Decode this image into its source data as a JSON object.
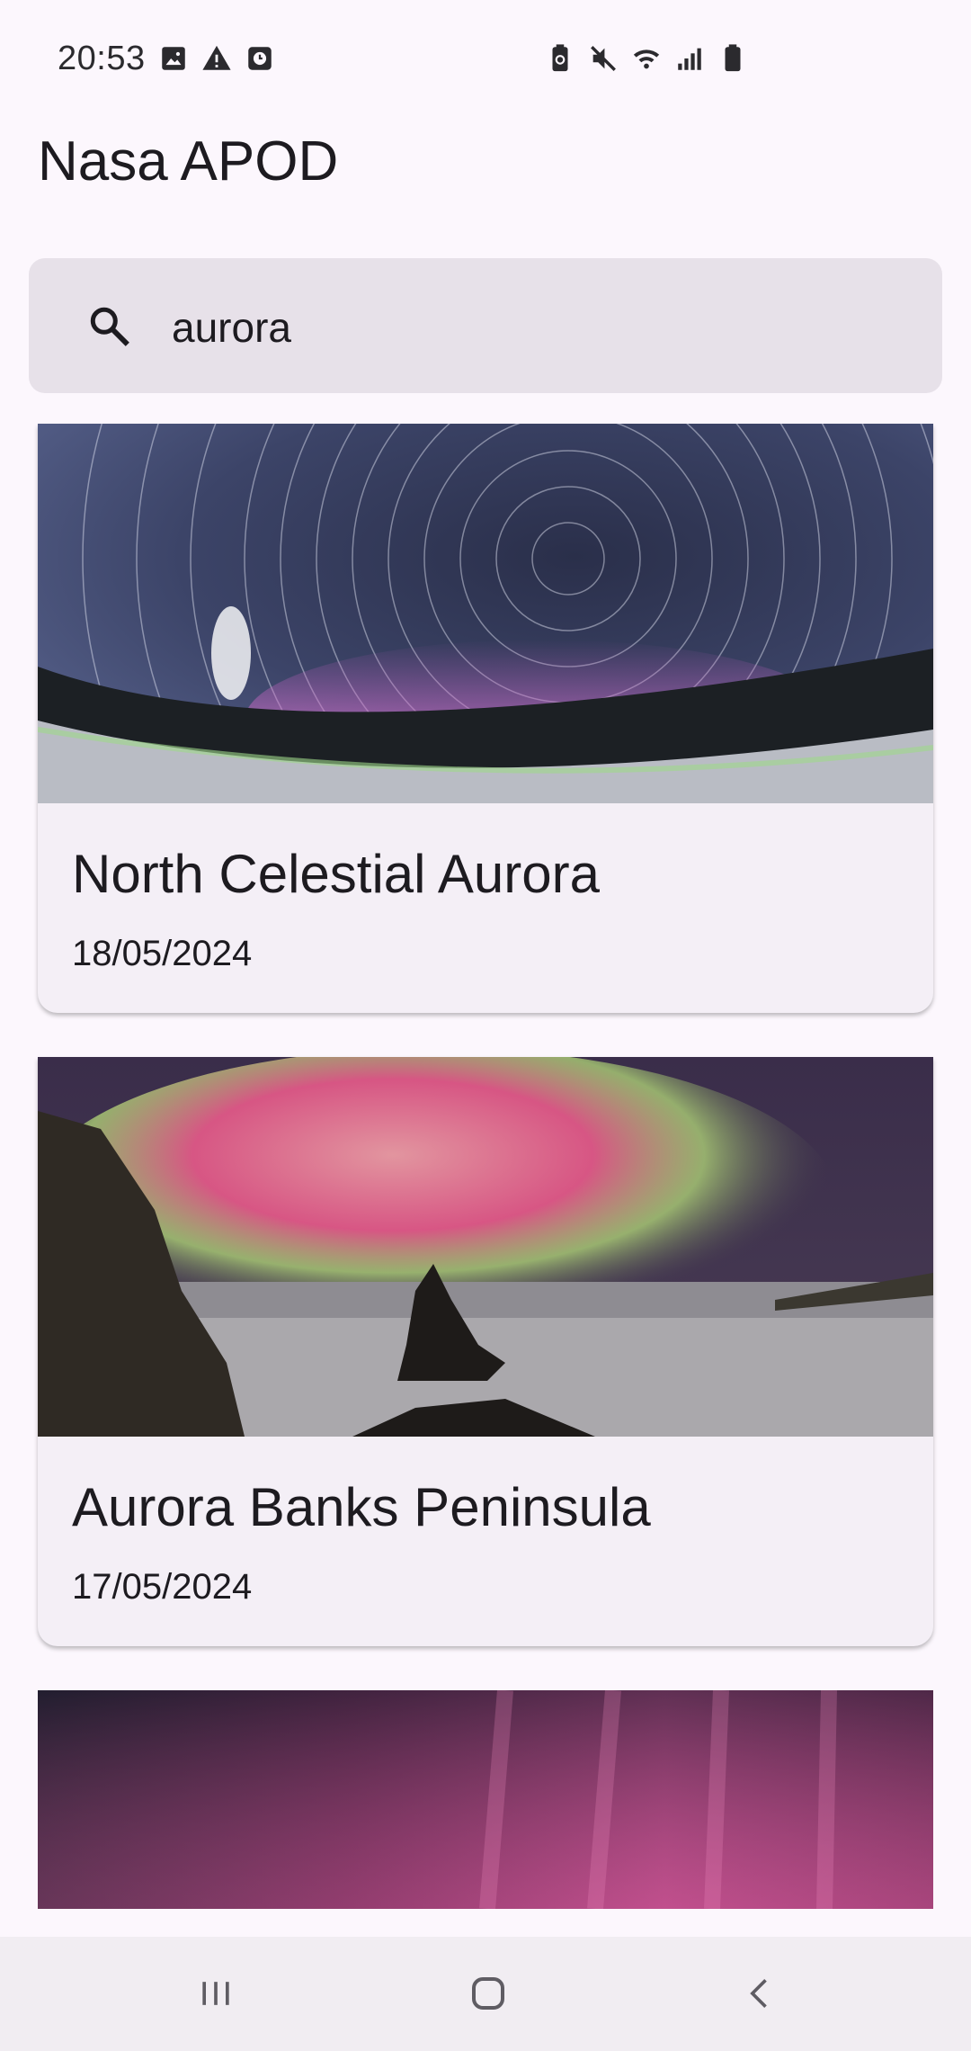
{
  "status_bar": {
    "time": "20:53",
    "left_icons": [
      "image-icon",
      "warning-icon",
      "clock-icon"
    ],
    "right_icons": [
      "battery-saver-icon",
      "mute-icon",
      "wifi-icon",
      "signal-icon",
      "battery-icon"
    ]
  },
  "app": {
    "title": "Nasa APOD"
  },
  "search": {
    "value": "aurora",
    "icon": "search-icon"
  },
  "cards": [
    {
      "title": "North Celestial Aurora",
      "date": "18/05/2024"
    },
    {
      "title": "Aurora Banks Peninsula",
      "date": "17/05/2024"
    }
  ],
  "nav": {
    "buttons": [
      "recents-icon",
      "home-icon",
      "back-icon"
    ]
  },
  "colors": {
    "background": "#fcf7fd",
    "search_bg": "#e7e1e9",
    "card_bg": "#f4eff6",
    "nav_bg": "#f1edf2"
  }
}
